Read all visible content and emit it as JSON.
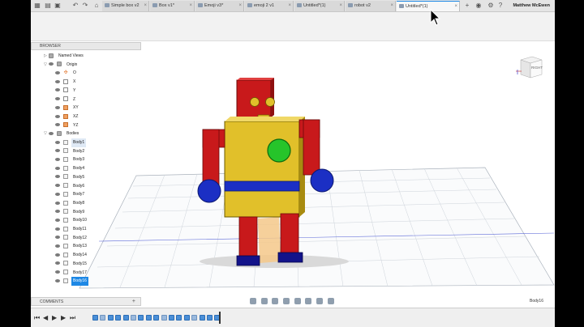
{
  "tabs": [
    {
      "label": "Simple box v2",
      "active": false
    },
    {
      "label": "Box v1*",
      "active": false
    },
    {
      "label": "Emoji v3*",
      "active": false
    },
    {
      "label": "emoji 2 v1",
      "active": false
    },
    {
      "label": "Untitled*(1)",
      "active": false
    },
    {
      "label": "robot v2",
      "active": false
    },
    {
      "label": "Untitled*(1)",
      "active": true
    }
  ],
  "user_name": "Matthew McEwen",
  "browser": {
    "title": "BROWSER",
    "named_views": "Named Views",
    "origin": "Origin",
    "origin_items": [
      "O",
      "X",
      "Y",
      "Z",
      "XY",
      "XZ",
      "YZ"
    ],
    "bodies": "Bodies",
    "body_items": [
      "Body1",
      "Body2",
      "Body3",
      "Body4",
      "Body5",
      "Body6",
      "Body7",
      "Body8",
      "Body9",
      "Body10",
      "Body11",
      "Body12",
      "Body13",
      "Body14",
      "Body15",
      "Body17",
      "Body16"
    ],
    "selected": "Body16"
  },
  "comments_label": "COMMENTS",
  "viewcube_label": "RIGHT",
  "status_selection": "Body16",
  "colors": {
    "accent": "#1e88e5",
    "robot_red": "#c8191b",
    "robot_yellow": "#e1c02a",
    "robot_blue": "#1b2fc4",
    "robot_green": "#26c42a",
    "robot_navy": "#13138a"
  },
  "icons": {
    "new": "new-file-icon",
    "open": "folder-icon",
    "save": "save-icon",
    "undo": "undo-icon",
    "redo": "redo-icon",
    "home": "home-icon",
    "add_tab": "plus-icon",
    "settings": "gear-icon",
    "help": "help-icon",
    "cursor": "pointer-cursor-icon"
  }
}
